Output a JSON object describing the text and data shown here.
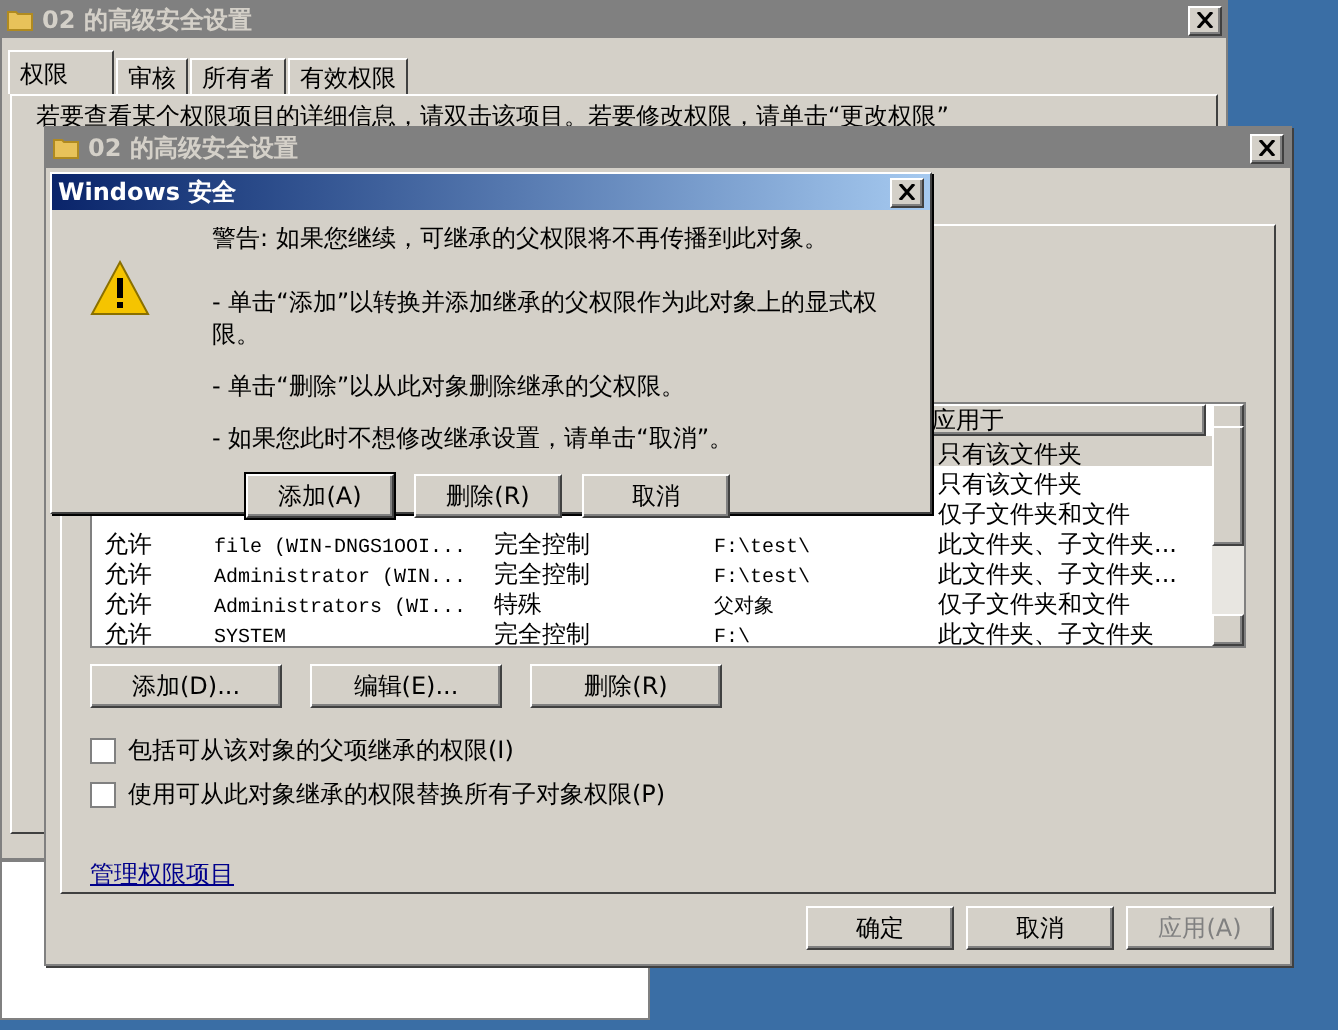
{
  "back_window": {
    "title": "02 的高级安全设置",
    "tabs": [
      {
        "label": "权限",
        "selected": true
      },
      {
        "label": "审核",
        "selected": false
      },
      {
        "label": "所有者",
        "selected": false
      },
      {
        "label": "有效权限",
        "selected": false
      }
    ],
    "description": "若要查看某个权限项目的详细信息，请双击该项目。若要修改权限，请单击“更改权限”"
  },
  "window": {
    "title": "02 的高级安全设置",
    "table": {
      "header": "应用于",
      "rows": [
        {
          "selected": true,
          "applies_to": "只有该文件夹"
        },
        {
          "selected": false,
          "applies_to": "只有该文件夹"
        },
        {
          "selected": false,
          "applies_to": "仅子文件夹和文件"
        },
        {
          "selected": false,
          "type": "允许",
          "name": "file (WIN-DNGS1OOI...",
          "permission": "完全控制",
          "inherited_from": "F:\\test\\",
          "applies_to": "此文件夹、子文件夹..."
        },
        {
          "selected": false,
          "type": "允许",
          "name": "Administrator (WIN...",
          "permission": "完全控制",
          "inherited_from": "F:\\test\\",
          "applies_to": "此文件夹、子文件夹..."
        },
        {
          "selected": false,
          "type": "允许",
          "name": "Administrators (WI...",
          "permission": "特殊",
          "inherited_from": "父对象",
          "applies_to": "仅子文件夹和文件"
        },
        {
          "selected": false,
          "type": "允许",
          "name": "SYSTEM",
          "permission": "完全控制",
          "inherited_from": "F:\\",
          "applies_to": "此文件夹、子文件夹"
        }
      ]
    },
    "buttons": [
      "添加(D)...",
      "编辑(E)...",
      "删除(R)"
    ],
    "checkboxes": [
      {
        "label": "包括可从该对象的父项继承的权限(I)",
        "checked": false
      },
      {
        "label": "使用可从此对象继承的权限替换所有子对象权限(P)",
        "checked": false
      }
    ],
    "link": "管理权限项目",
    "footer_buttons": [
      {
        "label": "确定",
        "disabled": false
      },
      {
        "label": "取消",
        "disabled": false
      },
      {
        "label": "应用(A)",
        "disabled": true
      }
    ]
  },
  "dialog": {
    "title": "Windows 安全",
    "messages": [
      "警告: 如果您继续，可继承的父权限将不再传播到此对象。",
      "- 单击“添加”以转换并添加继承的父权限作为此对象上的显式权限。",
      "- 单击“删除”以从此对象删除继承的父权限。",
      "- 如果您此时不想修改继承设置，请单击“取消”。"
    ],
    "buttons": [
      {
        "label": "添加(A)",
        "default": true
      },
      {
        "label": "删除(R)",
        "default": false
      },
      {
        "label": "取消",
        "default": false
      }
    ]
  }
}
